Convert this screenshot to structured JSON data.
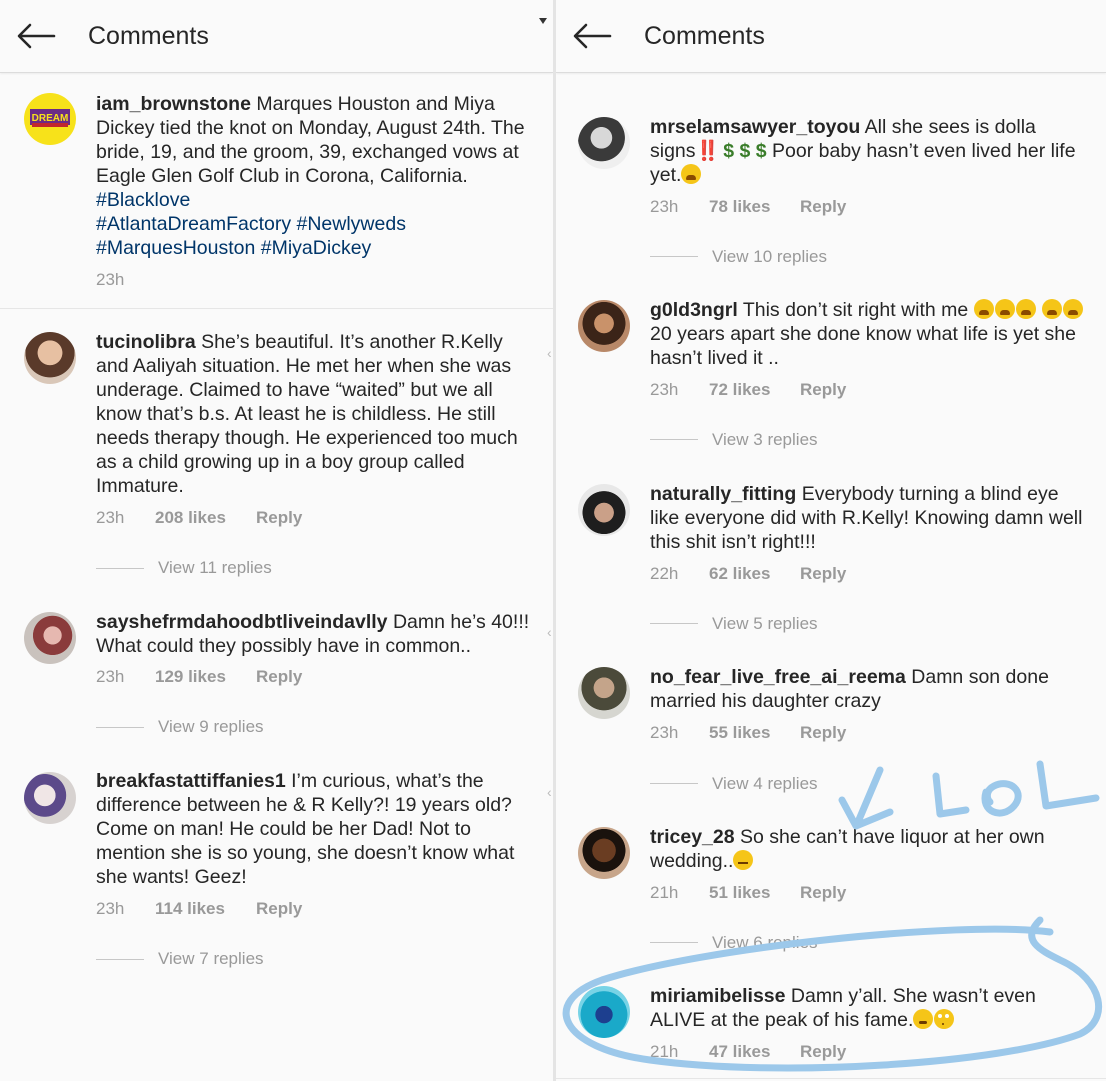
{
  "header": {
    "title": "Comments"
  },
  "left": {
    "post": {
      "username": "iam_brownstone",
      "text": "Marques Houston and Miya Dickey tied the knot on Monday, August 24th. The bride, 19, and the groom, 39, exchanged vows at Eagle Glen Golf Club in Corona, California.",
      "hashtags": [
        "#Blacklove",
        "#AtlantaDreamFactory",
        "#Newlyweds",
        "#MarquesHouston",
        "#MiyaDickey"
      ],
      "time": "23h",
      "avatar_text": "DREAM"
    },
    "comments": [
      {
        "username": "tucinolibra",
        "text": "She’s beautiful. It’s another R.Kelly and Aaliyah situation. He met her when she was underage. Claimed to have “waited” but we all know that’s b.s. At least he is childless. He still needs therapy though. He experienced too much as a child growing up in a boy group called Immature.",
        "time": "23h",
        "likes": "208 likes",
        "reply": "Reply",
        "view_replies": "View 11 replies"
      },
      {
        "username": "sayshefrmdahoodbtliveindavlly",
        "text": "Damn he’s 40!!! What could they possibly have in common..",
        "time": "23h",
        "likes": "129 likes",
        "reply": "Reply",
        "view_replies": "View 9 replies"
      },
      {
        "username": "breakfastattiffanies1",
        "text": "I’m curious, what’s the difference between he & R Kelly?! 19 years old? Come on man! He could be her Dad!  Not to mention she is so young, she doesn’t know what she wants! Geez!",
        "time": "23h",
        "likes": "114 likes",
        "reply": "Reply",
        "view_replies": "View 7 replies"
      }
    ]
  },
  "right": {
    "comments": [
      {
        "username": "mrselamsawyer_toyou",
        "text_a": "All she sees is dolla signs",
        "bangbang": "‼️",
        "dollars": "$ $ $",
        "text_b": "Poor baby hasn’t even lived her life yet.",
        "time": "23h",
        "likes": "78 likes",
        "reply": "Reply",
        "view_replies": "View 10 replies"
      },
      {
        "username": "g0ld3ngrl",
        "text_a": "This don’t sit right with me",
        "text_b": "20 years apart she done know what life is yet she hasn’t lived it ..",
        "time": "23h",
        "likes": "72 likes",
        "reply": "Reply",
        "view_replies": "View 3 replies"
      },
      {
        "username": "naturally_fitting",
        "text": "Everybody turning a blind eye like everyone did with R.Kelly! Knowing damn well this shit isn’t right!!!",
        "time": "22h",
        "likes": "62 likes",
        "reply": "Reply",
        "view_replies": "View 5 replies"
      },
      {
        "username": "no_fear_live_free_ai_reema",
        "text": "Damn son done married his daughter crazy",
        "time": "23h",
        "likes": "55 likes",
        "reply": "Reply",
        "view_replies": "View 4 replies"
      },
      {
        "username": "tricey_28",
        "text": "So she can’t have liquor at her own wedding..",
        "time": "21h",
        "likes": "51 likes",
        "reply": "Reply",
        "view_replies": "View 6 replies"
      },
      {
        "username": "miriamibelisse",
        "text": "Damn y’all. She wasn’t even ALIVE at the peak of his fame.",
        "time": "21h",
        "likes": "47 likes",
        "reply": "Reply"
      }
    ]
  },
  "annotation": {
    "text": "LOL",
    "color": "#9cc8ea"
  }
}
